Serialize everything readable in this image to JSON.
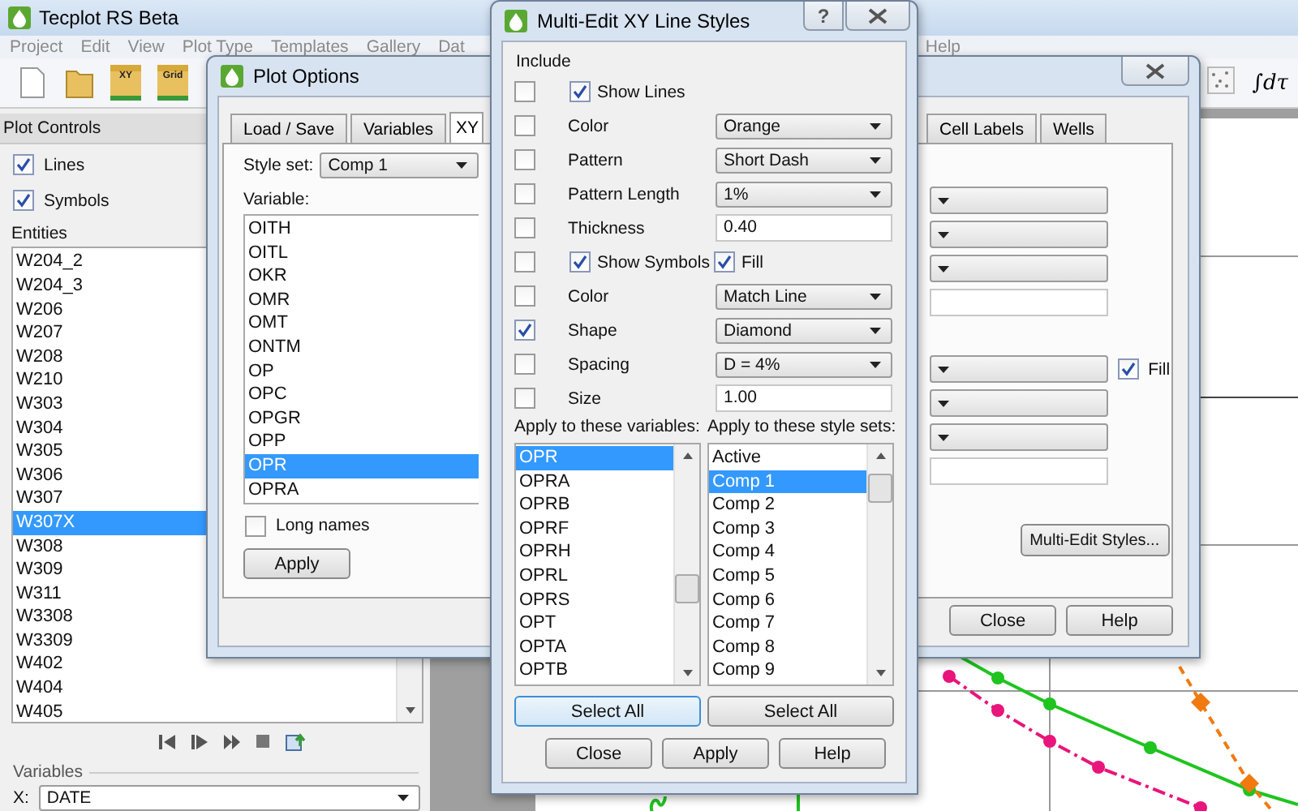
{
  "app": {
    "title": "Tecplot RS Beta",
    "menu": [
      "Project",
      "Edit",
      "View",
      "Plot Type",
      "Templates",
      "Gallery",
      "Dat",
      "Help"
    ],
    "toolbar": [
      {
        "kind": "new"
      },
      {
        "kind": "open"
      },
      {
        "kind": "xy",
        "label": "XY"
      },
      {
        "kind": "grid",
        "label": "Grid"
      }
    ],
    "toolbar_right": [
      {
        "kind": "scatter"
      },
      {
        "kind": "integral",
        "label": "∫dτ"
      }
    ]
  },
  "plot_controls": {
    "title": "Plot Controls",
    "options": [
      {
        "label": "Lines",
        "checked": true
      },
      {
        "label": "Symbols",
        "checked": true
      }
    ],
    "entities_label": "Entities",
    "entities": [
      {
        "label": "W204_2",
        "selected": false
      },
      {
        "label": "W204_3",
        "selected": false
      },
      {
        "label": "W206",
        "selected": false
      },
      {
        "label": "W207",
        "selected": false
      },
      {
        "label": "W208",
        "selected": false
      },
      {
        "label": "W210",
        "selected": false
      },
      {
        "label": "W303",
        "selected": false
      },
      {
        "label": "W304",
        "selected": false
      },
      {
        "label": "W305",
        "selected": false
      },
      {
        "label": "W306",
        "selected": false
      },
      {
        "label": "W307",
        "selected": false
      },
      {
        "label": "W307X",
        "selected": true
      },
      {
        "label": "W308",
        "selected": false
      },
      {
        "label": "W309",
        "selected": false
      },
      {
        "label": "W311",
        "selected": false
      },
      {
        "label": "W3308",
        "selected": false
      },
      {
        "label": "W3309",
        "selected": false
      },
      {
        "label": "W402",
        "selected": false
      },
      {
        "label": "W404",
        "selected": false
      },
      {
        "label": "W405",
        "selected": false
      }
    ],
    "variables_title": "Variables",
    "x_label": "X:",
    "x_value": "DATE"
  },
  "plot_options": {
    "title": "Plot Options",
    "tabs": [
      {
        "label": "Load / Save",
        "selected": false
      },
      {
        "label": "Variables",
        "selected": false
      },
      {
        "label": "XY",
        "selected": true
      },
      {
        "label": "Cell Labels",
        "selected": false
      },
      {
        "label": "Wells",
        "selected": false
      }
    ],
    "style_set_label": "Style set:",
    "style_set": "Comp 1",
    "variable_label": "Variable:",
    "variables": [
      {
        "label": "OITH",
        "selected": false
      },
      {
        "label": "OITL",
        "selected": false
      },
      {
        "label": "OKR",
        "selected": false
      },
      {
        "label": "OMR",
        "selected": false
      },
      {
        "label": "OMT",
        "selected": false
      },
      {
        "label": "ONTM",
        "selected": false
      },
      {
        "label": "OP",
        "selected": false
      },
      {
        "label": "OPC",
        "selected": false
      },
      {
        "label": "OPGR",
        "selected": false
      },
      {
        "label": "OPP",
        "selected": false
      },
      {
        "label": "OPR",
        "selected": true
      },
      {
        "label": "OPRA",
        "selected": false
      }
    ],
    "long_names": {
      "label": "Long names",
      "checked": false
    },
    "apply": "Apply",
    "right_groups": [
      [
        {
          "kind": "dropdown"
        },
        {
          "kind": "dropdown"
        },
        {
          "kind": "dropdown"
        },
        {
          "kind": "field"
        }
      ],
      [
        {
          "kind": "dropdown",
          "fill": {
            "label": "Fill",
            "checked": true
          }
        },
        {
          "kind": "dropdown"
        },
        {
          "kind": "dropdown"
        },
        {
          "kind": "field"
        }
      ]
    ],
    "multi_edit_button": "Multi-Edit Styles...",
    "buttons": [
      "Close",
      "Help"
    ]
  },
  "multi_edit": {
    "title": "Multi-Edit XY Line Styles",
    "help_glyph": "?",
    "include_label": "Include",
    "rows": [
      {
        "include": false,
        "kind": "check",
        "label": "Show Lines",
        "checked": true
      },
      {
        "include": false,
        "kind": "dropdown",
        "label": "Color",
        "value": "Orange"
      },
      {
        "include": false,
        "kind": "dropdown",
        "label": "Pattern",
        "value": "Short Dash"
      },
      {
        "include": false,
        "kind": "dropdown",
        "label": "Pattern Length",
        "value": "1%"
      },
      {
        "include": false,
        "kind": "field",
        "label": "Thickness",
        "value": "0.40"
      },
      {
        "include": false,
        "kind": "check",
        "label": "Show Symbols",
        "checked": true,
        "fill": {
          "label": "Fill",
          "checked": true
        }
      },
      {
        "include": false,
        "kind": "dropdown",
        "label": "Color",
        "value": "Match Line"
      },
      {
        "include": true,
        "kind": "dropdown",
        "label": "Shape",
        "value": "Diamond"
      },
      {
        "include": false,
        "kind": "dropdown",
        "label": "Spacing",
        "value": "D = 4%"
      },
      {
        "include": false,
        "kind": "field",
        "label": "Size",
        "value": "1.00"
      }
    ],
    "variables_label": "Apply to these variables:",
    "variables": [
      {
        "label": "OPR",
        "selected": true
      },
      {
        "label": "OPRA",
        "selected": false
      },
      {
        "label": "OPRB",
        "selected": false
      },
      {
        "label": "OPRF",
        "selected": false
      },
      {
        "label": "OPRH",
        "selected": false
      },
      {
        "label": "OPRL",
        "selected": false
      },
      {
        "label": "OPRS",
        "selected": false
      },
      {
        "label": "OPT",
        "selected": false
      },
      {
        "label": "OPTA",
        "selected": false
      },
      {
        "label": "OPTB",
        "selected": false
      }
    ],
    "style_sets_label": "Apply to these style sets:",
    "style_sets": [
      {
        "label": "Active",
        "selected": false
      },
      {
        "label": "Comp 1",
        "selected": true
      },
      {
        "label": "Comp 2",
        "selected": false
      },
      {
        "label": "Comp 3",
        "selected": false
      },
      {
        "label": "Comp 4",
        "selected": false
      },
      {
        "label": "Comp 5",
        "selected": false
      },
      {
        "label": "Comp 6",
        "selected": false
      },
      {
        "label": "Comp 7",
        "selected": false
      },
      {
        "label": "Comp 8",
        "selected": false
      },
      {
        "label": "Comp 9",
        "selected": false
      }
    ],
    "select_all": [
      {
        "label": "Select All",
        "focused": true
      },
      {
        "label": "Select All",
        "focused": false
      }
    ],
    "buttons": [
      "Close",
      "Apply",
      "Help"
    ]
  }
}
